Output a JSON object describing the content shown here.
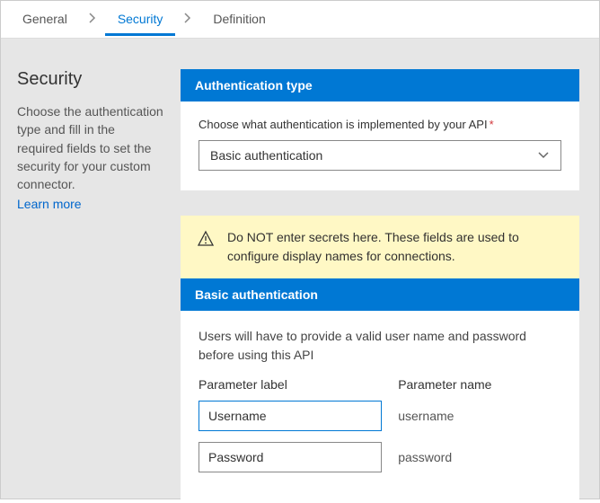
{
  "tabs": {
    "general": "General",
    "security": "Security",
    "definition": "Definition"
  },
  "sidebar": {
    "title": "Security",
    "description": "Choose the authentication type and fill in the required fields to set the security for your custom connector.",
    "learn_more": "Learn more"
  },
  "auth_type": {
    "header": "Authentication type",
    "label": "Choose what authentication is implemented by your API",
    "required_marker": "*",
    "selected": "Basic authentication"
  },
  "warning": {
    "text": "Do NOT enter secrets here. These fields are used to configure display names for connections."
  },
  "basic_auth": {
    "header": "Basic authentication",
    "description": "Users will have to provide a valid user name and password before using this API",
    "col_label": "Parameter label",
    "col_name": "Parameter name",
    "rows": [
      {
        "label": "Username",
        "name": "username"
      },
      {
        "label": "Password",
        "name": "password"
      }
    ]
  }
}
